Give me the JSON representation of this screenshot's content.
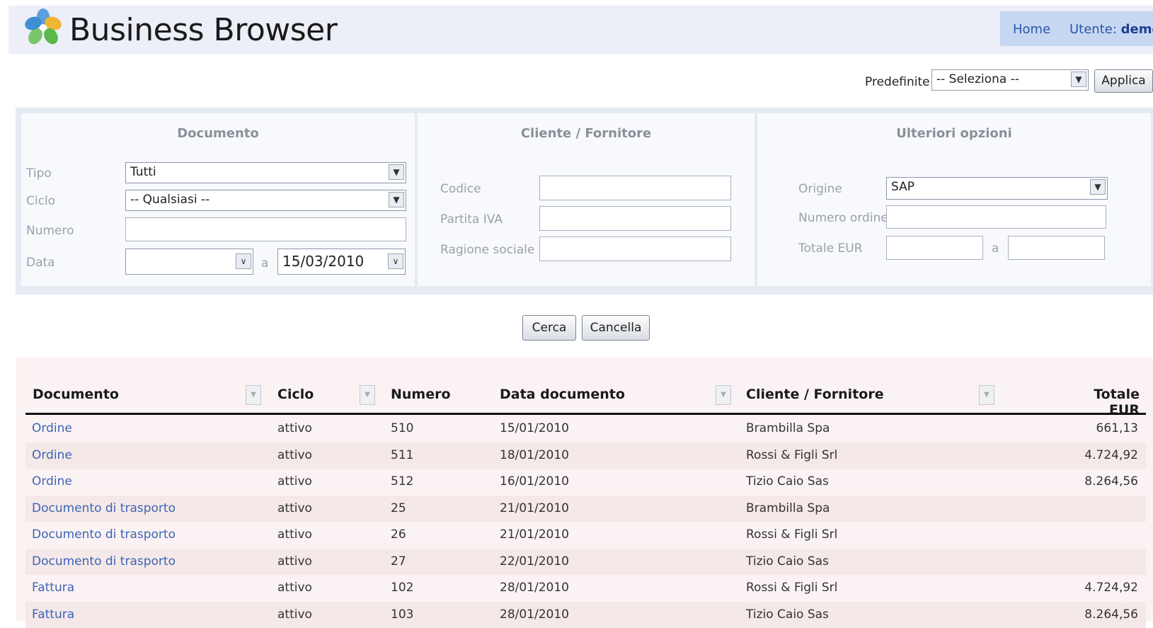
{
  "app": {
    "title": "Business Browser"
  },
  "nav": {
    "home": "Home",
    "user_label": "Utente:",
    "user_name": "demo"
  },
  "presets": {
    "label": "Predefinite",
    "selected": "-- Seleziona --",
    "apply": "Applica"
  },
  "filters": {
    "documento": {
      "heading": "Documento",
      "tipo_label": "Tipo",
      "tipo_value": "Tutti",
      "ciclo_label": "Ciclo",
      "ciclo_value": "-- Qualsiasi --",
      "numero_label": "Numero",
      "numero_value": "",
      "data_label": "Data",
      "data_from": "",
      "data_sep": "a",
      "data_to": "15/03/2010"
    },
    "cliente": {
      "heading": "Cliente / Fornitore",
      "codice_label": "Codice",
      "codice_value": "",
      "piva_label": "Partita IVA",
      "piva_value": "",
      "ragione_label": "Ragione sociale",
      "ragione_value": ""
    },
    "opzioni": {
      "heading": "Ulteriori opzioni",
      "origine_label": "Origine",
      "origine_value": "SAP",
      "ordine_label": "Numero ordine",
      "ordine_value": "",
      "totale_label": "Totale EUR",
      "totale_sep": "a",
      "totale_from": "",
      "totale_to": ""
    }
  },
  "actions": {
    "search": "Cerca",
    "cancel": "Cancella"
  },
  "table": {
    "columns": [
      "Documento",
      "Ciclo",
      "Numero",
      "Data documento",
      "Cliente / Fornitore",
      "Totale EUR"
    ],
    "rows": [
      [
        "Ordine",
        "attivo",
        "510",
        "15/01/2010",
        "Brambilla Spa",
        "661,13"
      ],
      [
        "Ordine",
        "attivo",
        "511",
        "18/01/2010",
        "Rossi & Figli Srl",
        "4.724,92"
      ],
      [
        "Ordine",
        "attivo",
        "512",
        "16/01/2010",
        "Tizio Caio Sas",
        "8.264,56"
      ],
      [
        "Documento di trasporto",
        "attivo",
        "25",
        "21/01/2010",
        "Brambilla Spa",
        ""
      ],
      [
        "Documento di trasporto",
        "attivo",
        "26",
        "21/01/2010",
        "Rossi & Figli Srl",
        ""
      ],
      [
        "Documento di trasporto",
        "attivo",
        "27",
        "22/01/2010",
        "Tizio Caio Sas",
        ""
      ],
      [
        "Fattura",
        "attivo",
        "102",
        "28/01/2010",
        "Rossi & Figli Srl",
        "4.724,92"
      ],
      [
        "Fattura",
        "attivo",
        "103",
        "28/01/2010",
        "Tizio Caio Sas",
        "8.264,56"
      ]
    ]
  },
  "icons": {
    "logo": "flower-logo-icon",
    "dropdown": "chevron-down-icon",
    "column_filter": "column-filter-icon"
  },
  "colors": {
    "header_bg": "#eceef8",
    "nav_bg": "#c6d7f2",
    "link": "#3d63b6",
    "panel_bg": "#e6eaf3",
    "row_alt": "#f4e8e8"
  }
}
